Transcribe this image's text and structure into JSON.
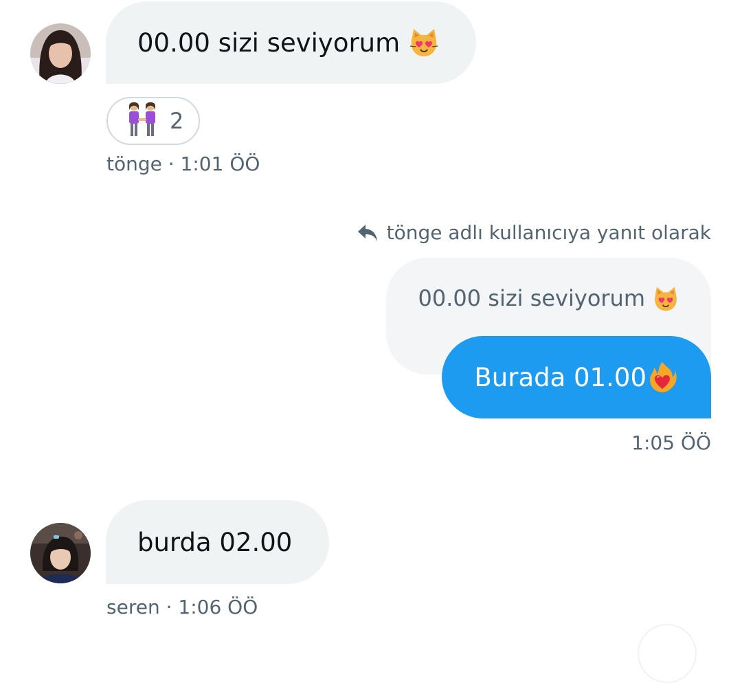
{
  "messages": [
    {
      "sender": "tönge",
      "text": "00.00 sizi seviyorum",
      "emoji": "smiling-cat-heart-eyes",
      "reaction": {
        "emoji": "two-women-holding-hands",
        "count": "2"
      },
      "meta": "tönge · 1:01 ÖÖ"
    },
    {
      "reply_to": "tönge adlı kullanıcıya yanıt olarak",
      "quoted_text": "00.00 sizi seviyorum",
      "quoted_emoji": "smiling-cat-heart-eyes",
      "text": "Burada 01.00",
      "emoji": "heart-on-fire",
      "meta": "1:05 ÖÖ"
    },
    {
      "sender": "seren",
      "text": "burda 02.00",
      "meta": "seren · 1:06 ÖÖ"
    }
  ],
  "colors": {
    "outgoing_bubble": "#1d9bf0",
    "incoming_bubble": "#eff3f4",
    "meta_text": "#536471",
    "primary_text": "#0f1419"
  }
}
